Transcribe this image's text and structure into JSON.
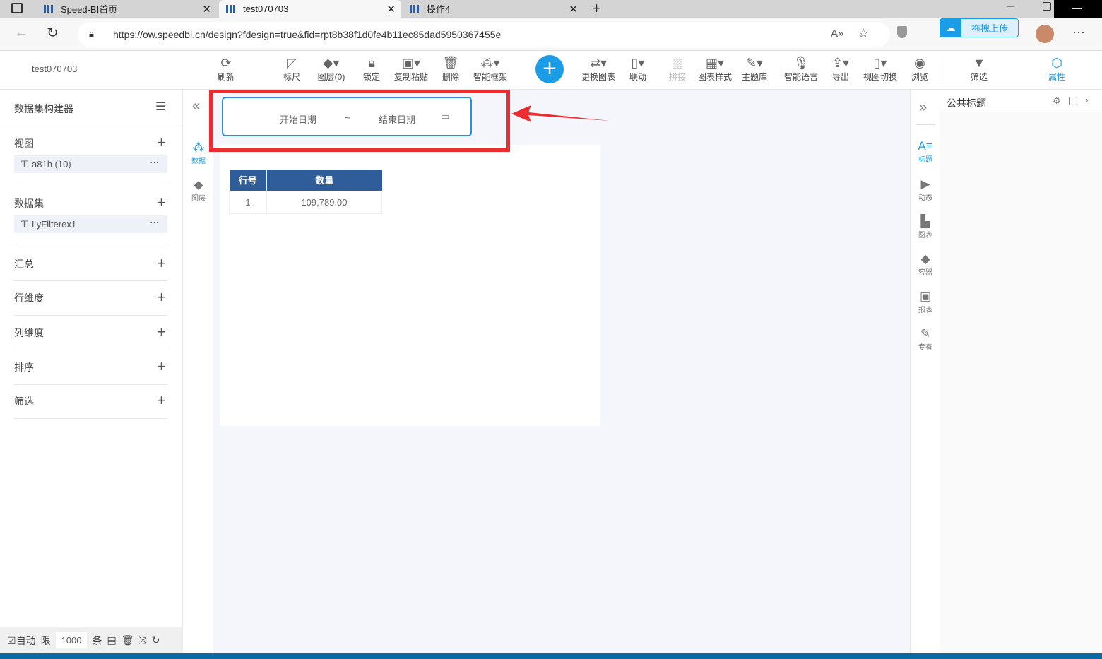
{
  "browser": {
    "tabs": [
      {
        "label": "Speed-BI首页"
      },
      {
        "label": "test070703"
      },
      {
        "label": "操作4"
      }
    ],
    "url": "https://ow.speedbi.cn/design?fdesign=true&fid=rpt8b38f1d0fe4b11ec85dad5950367455e",
    "upload_label": "拖拽上传"
  },
  "app": {
    "title": "test070703"
  },
  "toolbar": {
    "items": [
      {
        "label": "刷新",
        "icon": "refresh-icon"
      },
      {
        "label": "标尺",
        "icon": "ruler-icon"
      },
      {
        "label": "图层(0)",
        "icon": "layers-icon"
      },
      {
        "label": "锁定",
        "icon": "lock-icon"
      },
      {
        "label": "复制粘贴",
        "icon": "copy-paste-icon"
      },
      {
        "label": "删除",
        "icon": "trash-icon"
      },
      {
        "label": "智能框架",
        "icon": "smart-frame-icon"
      },
      {
        "label": "更换图表",
        "icon": "switch-chart-icon"
      },
      {
        "label": "联动",
        "icon": "linkage-icon"
      },
      {
        "label": "拼接",
        "icon": "splice-icon"
      },
      {
        "label": "图表样式",
        "icon": "chart-style-icon"
      },
      {
        "label": "主题库",
        "icon": "theme-brush-icon"
      },
      {
        "label": "智能语言",
        "icon": "microphone-icon"
      },
      {
        "label": "导出",
        "icon": "export-icon"
      },
      {
        "label": "视图切换",
        "icon": "phone-icon"
      },
      {
        "label": "浏览",
        "icon": "eye-icon"
      },
      {
        "label": "筛选",
        "icon": "filter-icon"
      },
      {
        "label": "属性",
        "icon": "hexagon-icon"
      }
    ],
    "add": "+"
  },
  "left": {
    "title": "数据集构建器",
    "sections": [
      {
        "label": "视图"
      },
      {
        "label": "数据集"
      },
      {
        "label": "汇总"
      },
      {
        "label": "行维度"
      },
      {
        "label": "列维度"
      },
      {
        "label": "排序"
      },
      {
        "label": "筛选"
      }
    ],
    "view_item": "a81h (10)",
    "dataset_item": "LyFilterex1",
    "bottom": {
      "auto": "自动",
      "limit": "限",
      "limit_value": "1000",
      "unit": "条"
    }
  },
  "rail": [
    {
      "label": "数据"
    },
    {
      "label": "图层"
    }
  ],
  "canvas": {
    "date_filter": {
      "start": "开始日期",
      "sep": "~",
      "end": "结束日期"
    },
    "table": {
      "headers": [
        "行号",
        "数量"
      ],
      "rows": [
        [
          "1",
          "109,789.00"
        ]
      ],
      "header_color": "#2f5d99"
    }
  },
  "right": {
    "panel_title": "公共标题",
    "rail": [
      {
        "label": "标题"
      },
      {
        "label": "动态"
      },
      {
        "label": "图表"
      },
      {
        "label": "容器"
      },
      {
        "label": "报表"
      },
      {
        "label": "专有"
      }
    ]
  },
  "colors": {
    "accent": "#1a9de6",
    "highlight": "#ee2b2f"
  }
}
